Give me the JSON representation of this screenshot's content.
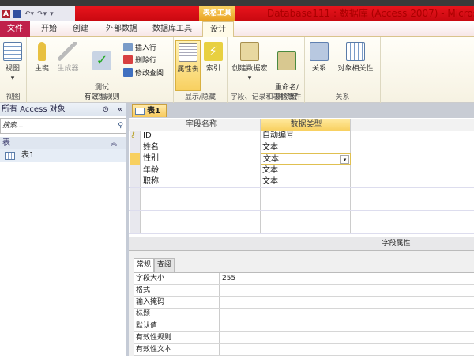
{
  "window": {
    "title": "Database111 : 数据库 (Access 2007) - Microso",
    "context_tab": "表格工具"
  },
  "ribbon_tabs": [
    "文件",
    "开始",
    "创建",
    "外部数据",
    "数据库工具",
    "设计"
  ],
  "ribbon": {
    "groups": [
      {
        "label": "视图",
        "buttons": [
          "视图"
        ]
      },
      {
        "label": "工具",
        "buttons": [
          "主键",
          "生成器",
          "测试\n有效性规则"
        ],
        "small": [
          "插入行",
          "删除行",
          "修改查阅"
        ]
      },
      {
        "label": "显示/隐藏",
        "buttons": [
          "属性表",
          "索引"
        ]
      },
      {
        "label": "字段、记录和表格事件",
        "buttons": [
          "创建数据宏",
          "重命名/\n删除宏"
        ]
      },
      {
        "label": "关系",
        "buttons": [
          "关系",
          "对象相关性"
        ]
      }
    ]
  },
  "nav": {
    "header": "所有 Access 对象",
    "search_placeholder": "搜索...",
    "section": "表",
    "items": [
      "表1"
    ]
  },
  "document": {
    "tab": "表1",
    "columns": [
      "字段名称",
      "数据类型"
    ],
    "rows": [
      {
        "name": "ID",
        "type": "自动编号",
        "key": true
      },
      {
        "name": "姓名",
        "type": "文本"
      },
      {
        "name": "性别",
        "type": "文本",
        "selected": true
      },
      {
        "name": "年龄",
        "type": "文本"
      },
      {
        "name": "职称",
        "type": "文本"
      }
    ]
  },
  "field_properties": {
    "title": "字段属性",
    "tabs": [
      "常规",
      "查阅"
    ],
    "rows": [
      {
        "label": "字段大小",
        "value": "255"
      },
      {
        "label": "格式",
        "value": ""
      },
      {
        "label": "输入掩码",
        "value": ""
      },
      {
        "label": "标题",
        "value": ""
      },
      {
        "label": "默认值",
        "value": ""
      },
      {
        "label": "有效性规则",
        "value": ""
      },
      {
        "label": "有效性文本",
        "value": ""
      }
    ]
  }
}
